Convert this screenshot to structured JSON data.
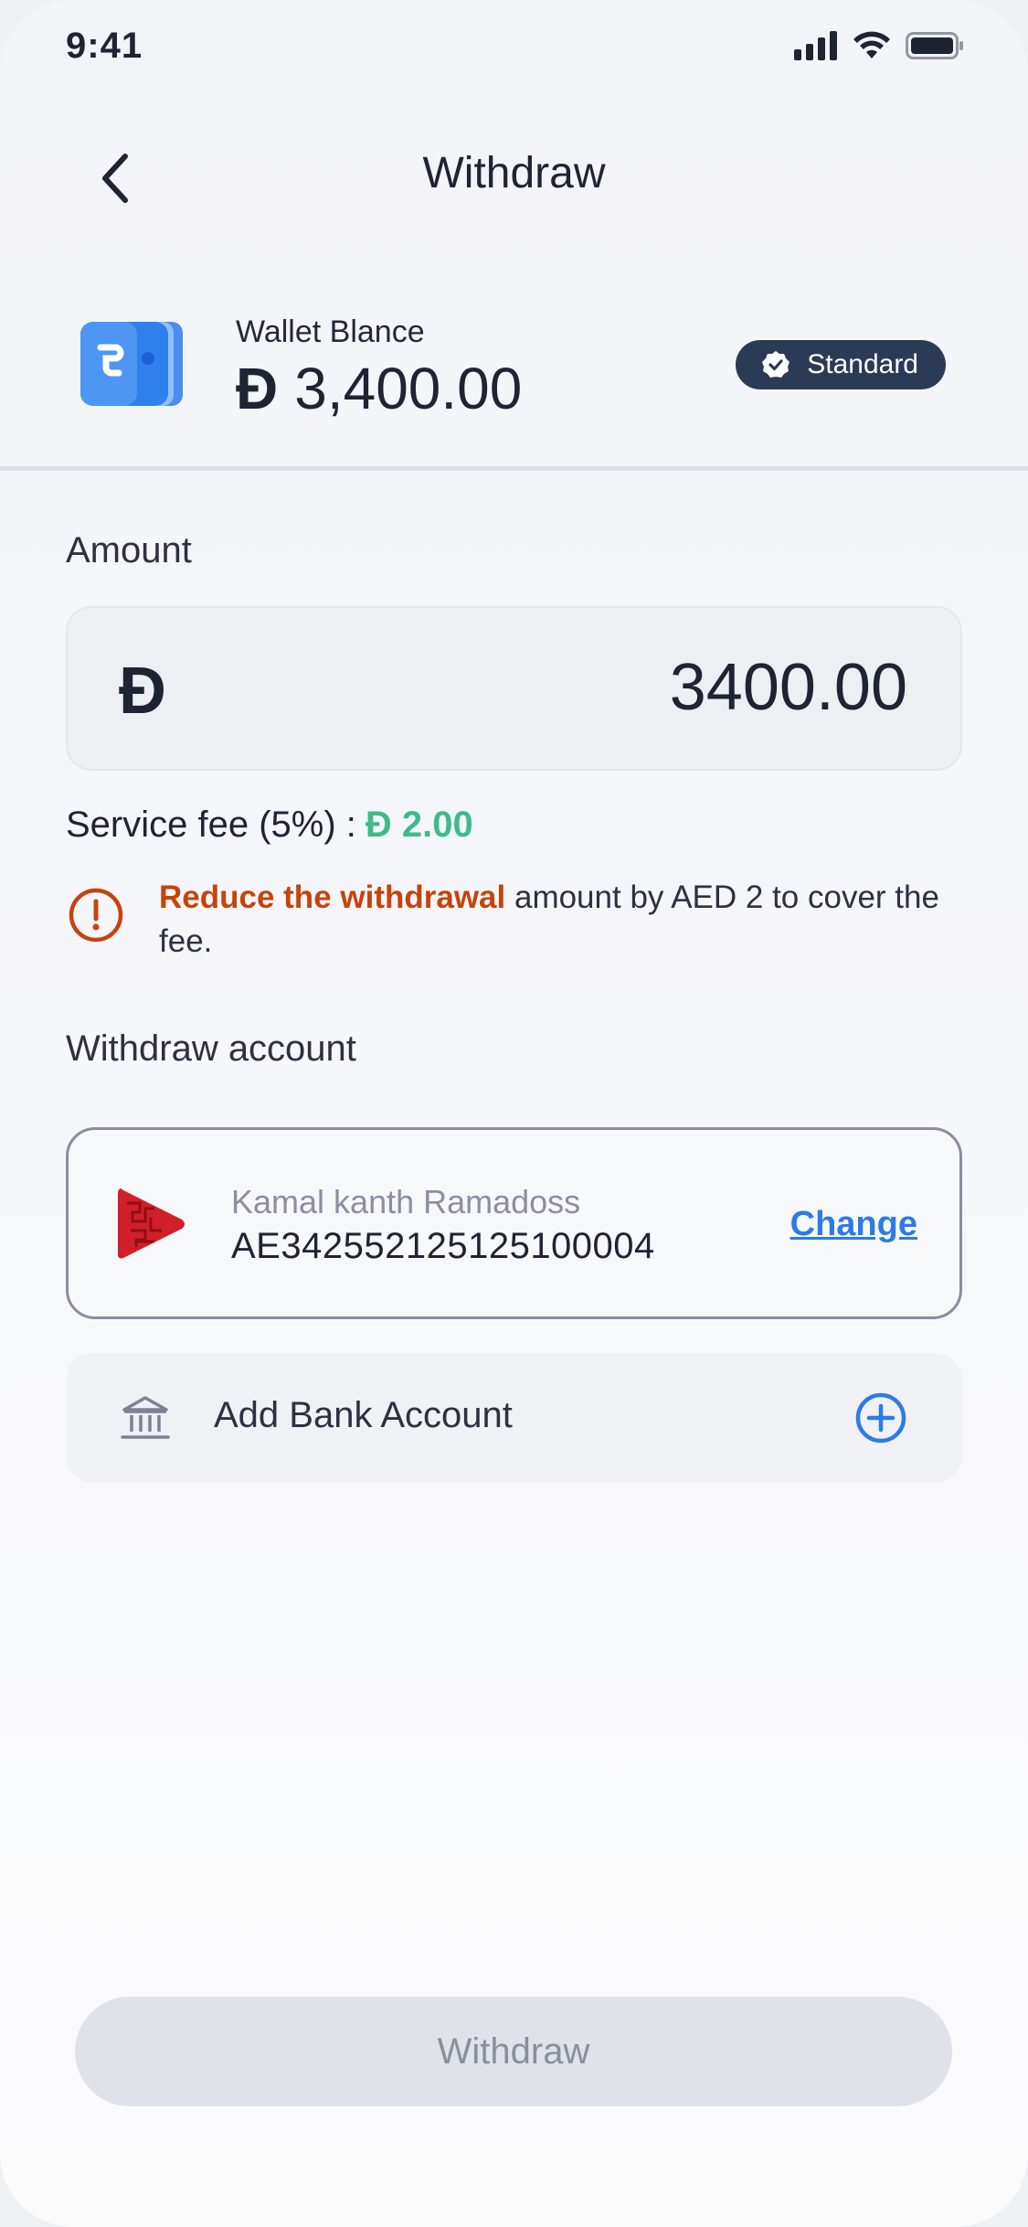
{
  "status_bar": {
    "time": "9:41"
  },
  "header": {
    "title": "Withdraw"
  },
  "wallet": {
    "label": "Wallet Blance",
    "currency_symbol": "Đ",
    "balance": "3,400.00",
    "tier": "Standard"
  },
  "amount": {
    "label": "Amount",
    "currency_symbol": "Đ",
    "value": "3400.00"
  },
  "service_fee": {
    "label": "Service fee (5%) :",
    "currency_symbol": "Đ",
    "value": "2.00"
  },
  "warning": {
    "strong": "Reduce the withdrawal",
    "rest": " amount by AED 2 to cover the fee."
  },
  "withdraw_account": {
    "label": "Withdraw account",
    "holder_name": "Kamal kanth Ramadoss",
    "iban": "AE342552125125100004",
    "change_label": "Change"
  },
  "add_bank": {
    "label": "Add Bank Account"
  },
  "withdraw_button": {
    "label": "Withdraw"
  },
  "colors": {
    "accent": "#2c7be5",
    "fee_green": "#3dbb8a",
    "warning": "#c7430c",
    "badge_bg": "#2b3a55"
  }
}
